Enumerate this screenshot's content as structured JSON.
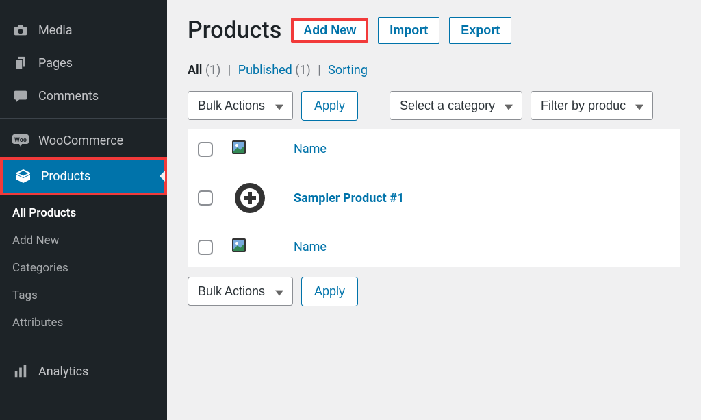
{
  "sidebar": {
    "items": [
      {
        "label": "Media",
        "icon": "camera"
      },
      {
        "label": "Pages",
        "icon": "pages"
      },
      {
        "label": "Comments",
        "icon": "comment"
      },
      {
        "label": "WooCommerce",
        "icon": "woo"
      },
      {
        "label": "Products",
        "icon": "box",
        "active": true
      },
      {
        "label": "Analytics",
        "icon": "stats"
      }
    ],
    "submenu": [
      {
        "label": "All Products",
        "current": true
      },
      {
        "label": "Add New"
      },
      {
        "label": "Categories"
      },
      {
        "label": "Tags"
      },
      {
        "label": "Attributes"
      }
    ]
  },
  "page": {
    "title": "Products",
    "buttons": {
      "add_new": "Add New",
      "import": "Import",
      "export": "Export"
    }
  },
  "filters": {
    "all_label": "All",
    "all_count": "(1)",
    "published_label": "Published",
    "published_count": "(1)",
    "sorting_label": "Sorting"
  },
  "controls": {
    "bulk_actions": "Bulk Actions",
    "apply": "Apply",
    "select_category": "Select a category",
    "filter_product": "Filter by produc"
  },
  "table": {
    "columns": {
      "name": "Name"
    },
    "rows": [
      {
        "name": "Sampler Product #1"
      }
    ]
  }
}
